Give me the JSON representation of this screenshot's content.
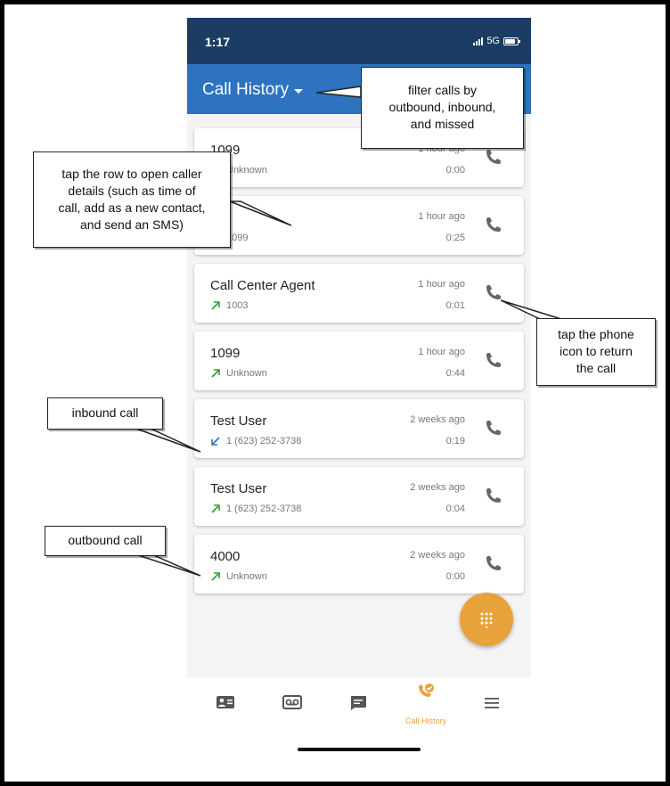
{
  "status": {
    "time": "1:17",
    "network": "5G"
  },
  "header": {
    "title": "Call History"
  },
  "calls": [
    {
      "name": "1099",
      "direction": "outbound",
      "number": "Unknown",
      "time": "1 hour ago",
      "duration": "0:00"
    },
    {
      "name": "",
      "direction": "outbound",
      "number": "1099",
      "time": "1 hour ago",
      "duration": "0:25"
    },
    {
      "name": "Call Center Agent",
      "direction": "outbound",
      "number": "1003",
      "time": "1 hour ago",
      "duration": "0:01"
    },
    {
      "name": "1099",
      "direction": "outbound",
      "number": "Unknown",
      "time": "1 hour ago",
      "duration": "0:44"
    },
    {
      "name": "Test User",
      "direction": "inbound",
      "number": "1 (623) 252-3738",
      "time": "2 weeks ago",
      "duration": "0:19"
    },
    {
      "name": "Test User",
      "direction": "outbound",
      "number": "1 (623) 252-3738",
      "time": "2 weeks ago",
      "duration": "0:04"
    },
    {
      "name": "4000",
      "direction": "outbound",
      "number": "Unknown",
      "time": "2 weeks ago",
      "duration": "0:00"
    }
  ],
  "nav": {
    "items": [
      {
        "icon": "contacts-icon",
        "label": ""
      },
      {
        "icon": "voicemail-icon",
        "label": ""
      },
      {
        "icon": "messages-icon",
        "label": ""
      },
      {
        "icon": "call-history-icon",
        "label": "Call History"
      },
      {
        "icon": "menu-icon",
        "label": ""
      }
    ]
  },
  "callouts": {
    "filter": [
      "filter calls by",
      "outbound, inbound,",
      "and missed"
    ],
    "tap_row": [
      "tap the row to open caller",
      "details (such as time of",
      "call, add as a new contact,",
      "and send an SMS)"
    ],
    "phone_icon": [
      "tap the phone",
      "icon to return",
      "the call"
    ],
    "inbound": [
      "inbound call"
    ],
    "outbound": [
      "outbound call"
    ]
  },
  "colors": {
    "status_bar": "#1b3d63",
    "header": "#2d73c0",
    "accent": "#e8a23a",
    "outbound_arrow": "#2e9e3a",
    "inbound_arrow": "#2d73c0"
  }
}
